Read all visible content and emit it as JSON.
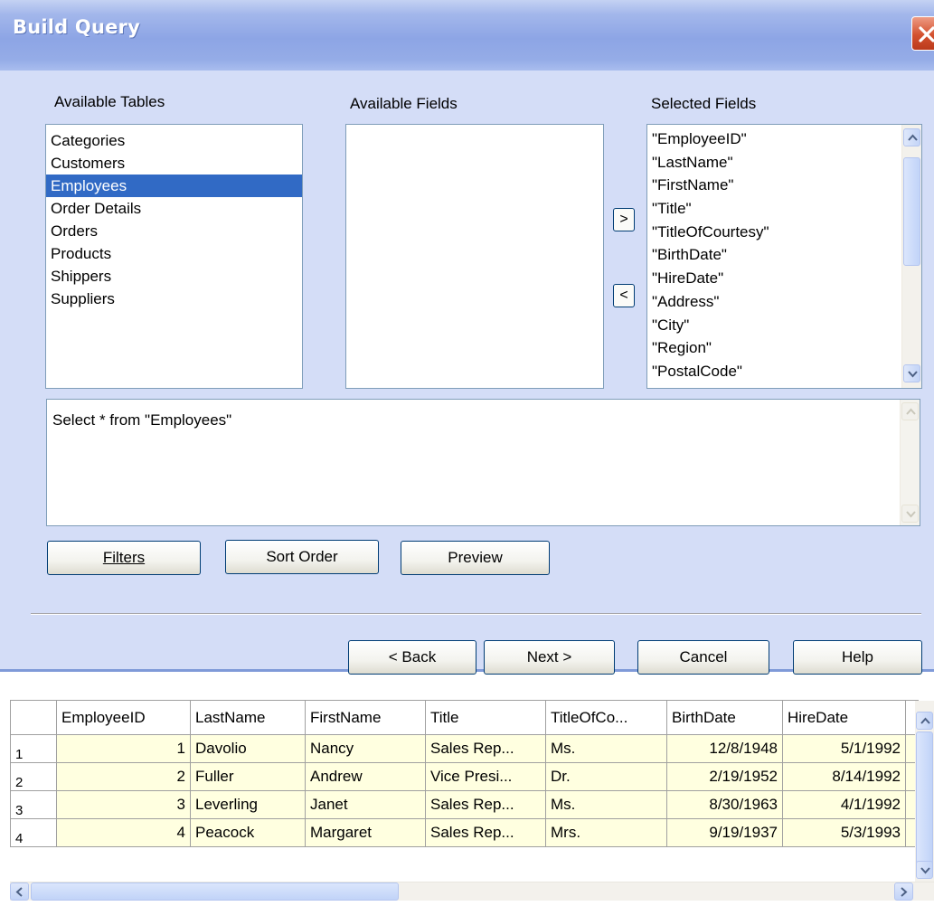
{
  "dialog": {
    "title": "Build Query",
    "labels": {
      "available_tables": "Available Tables",
      "available_fields": "Available Fields",
      "selected_fields": "Selected Fields"
    },
    "available_tables": [
      "Categories",
      "Customers",
      "Employees",
      "Order Details",
      "Orders",
      "Products",
      "Shippers",
      "Suppliers"
    ],
    "selected_table": "Employees",
    "available_fields": [],
    "selected_fields": [
      "\"EmployeeID\"",
      "\"LastName\"",
      "\"FirstName\"",
      "\"Title\"",
      "\"TitleOfCourtesy\"",
      "\"BirthDate\"",
      "\"HireDate\"",
      "\"Address\"",
      "\"City\"",
      "\"Region\"",
      "\"PostalCode\""
    ],
    "add_button": ">",
    "remove_button": "<",
    "sql_text": "Select * from \"Employees\"",
    "buttons": {
      "filters": "Filters",
      "sort_order": "Sort Order",
      "preview": "Preview",
      "back": "< Back",
      "next": "Next >",
      "cancel": "Cancel",
      "help": "Help"
    }
  },
  "grid": {
    "columns": [
      "EmployeeID",
      "LastName",
      "FirstName",
      "Title",
      "TitleOfCo...",
      "BirthDate",
      "HireDate"
    ],
    "rows": [
      {
        "row": "1",
        "cells": [
          "1",
          "Davolio",
          "Nancy",
          "Sales Rep...",
          "Ms.",
          "12/8/1948",
          "5/1/1992"
        ]
      },
      {
        "row": "2",
        "cells": [
          "2",
          "Fuller",
          "Andrew",
          "Vice Presi...",
          "Dr.",
          "2/19/1952",
          "8/14/1992"
        ]
      },
      {
        "row": "3",
        "cells": [
          "3",
          "Leverling",
          "Janet",
          "Sales Rep...",
          "Ms.",
          "8/30/1963",
          "4/1/1992"
        ]
      },
      {
        "row": "4",
        "cells": [
          "4",
          "Peacock",
          "Margaret",
          "Sales Rep...",
          "Mrs.",
          "9/19/1937",
          "5/3/1993"
        ]
      }
    ]
  }
}
